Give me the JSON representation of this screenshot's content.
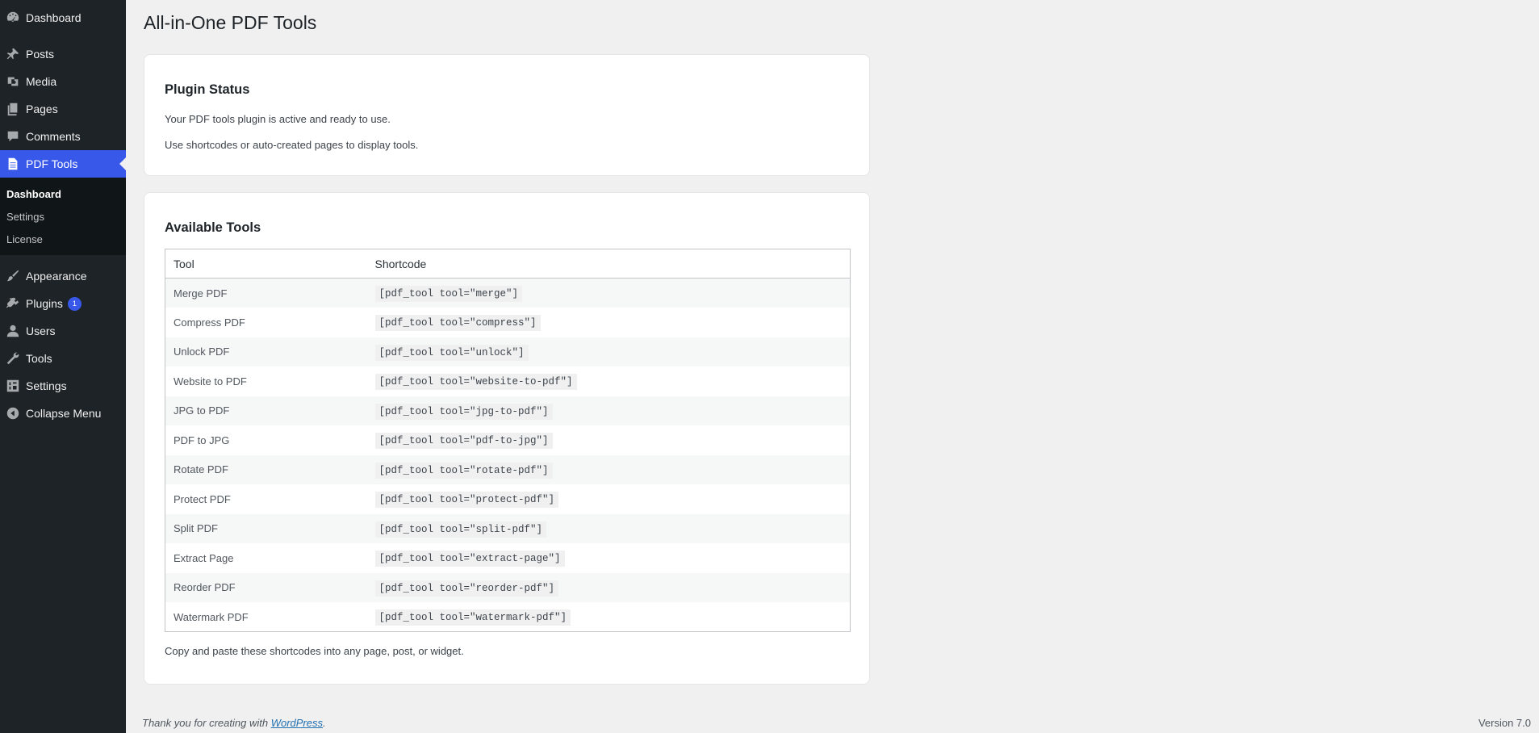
{
  "sidebar": {
    "items": [
      {
        "label": "Dashboard",
        "icon": "dashboard-icon"
      },
      {
        "label": "Posts",
        "icon": "pushpin-icon"
      },
      {
        "label": "Media",
        "icon": "media-icon"
      },
      {
        "label": "Pages",
        "icon": "pages-icon"
      },
      {
        "label": "Comments",
        "icon": "comment-icon"
      },
      {
        "label": "PDF Tools",
        "icon": "document-icon"
      }
    ],
    "submenu": [
      {
        "label": "Dashboard"
      },
      {
        "label": "Settings"
      },
      {
        "label": "License"
      }
    ],
    "items2": [
      {
        "label": "Appearance",
        "icon": "brush-icon"
      },
      {
        "label": "Plugins",
        "icon": "plugin-icon",
        "badge": "1"
      },
      {
        "label": "Users",
        "icon": "user-icon"
      },
      {
        "label": "Tools",
        "icon": "wrench-icon"
      },
      {
        "label": "Settings",
        "icon": "settings-icon"
      },
      {
        "label": "Collapse Menu",
        "icon": "collapse-icon"
      }
    ]
  },
  "page": {
    "title": "All-in-One PDF Tools"
  },
  "status_card": {
    "heading": "Plugin Status",
    "line1": "Your PDF tools plugin is active and ready to use.",
    "line2": "Use shortcodes or auto-created pages to display tools."
  },
  "tools_card": {
    "heading": "Available Tools",
    "columns": [
      "Tool",
      "Shortcode"
    ],
    "rows": [
      {
        "tool": "Merge PDF",
        "shortcode": "[pdf_tool tool=\"merge\"]"
      },
      {
        "tool": "Compress PDF",
        "shortcode": "[pdf_tool tool=\"compress\"]"
      },
      {
        "tool": "Unlock PDF",
        "shortcode": "[pdf_tool tool=\"unlock\"]"
      },
      {
        "tool": "Website to PDF",
        "shortcode": "[pdf_tool tool=\"website-to-pdf\"]"
      },
      {
        "tool": "JPG to PDF",
        "shortcode": "[pdf_tool tool=\"jpg-to-pdf\"]"
      },
      {
        "tool": "PDF to JPG",
        "shortcode": "[pdf_tool tool=\"pdf-to-jpg\"]"
      },
      {
        "tool": "Rotate PDF",
        "shortcode": "[pdf_tool tool=\"rotate-pdf\"]"
      },
      {
        "tool": "Protect PDF",
        "shortcode": "[pdf_tool tool=\"protect-pdf\"]"
      },
      {
        "tool": "Split PDF",
        "shortcode": "[pdf_tool tool=\"split-pdf\"]"
      },
      {
        "tool": "Extract Page",
        "shortcode": "[pdf_tool tool=\"extract-page\"]"
      },
      {
        "tool": "Reorder PDF",
        "shortcode": "[pdf_tool tool=\"reorder-pdf\"]"
      },
      {
        "tool": "Watermark PDF",
        "shortcode": "[pdf_tool tool=\"watermark-pdf\"]"
      }
    ],
    "footer_note": "Copy and paste these shortcodes into any page, post, or widget."
  },
  "footer": {
    "thanks_prefix": "Thank you for creating with ",
    "link_text": "WordPress",
    "thanks_suffix": ".",
    "version": "Version 7.0"
  },
  "colors": {
    "sidebar_bg": "#1d2327",
    "accent": "#3858e9",
    "link": "#2271b1"
  }
}
